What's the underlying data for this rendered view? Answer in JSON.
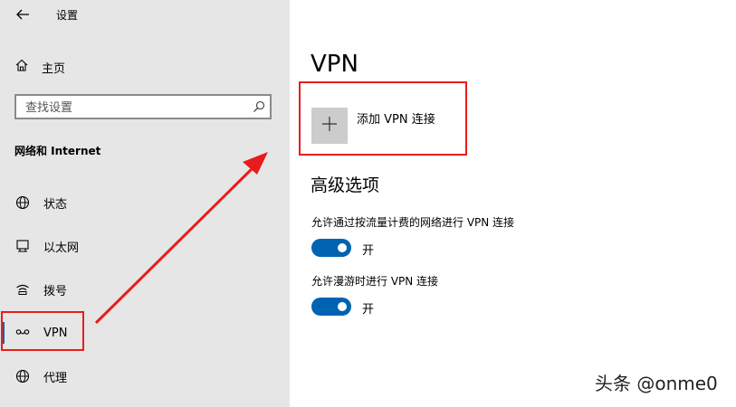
{
  "window": {
    "title": "设置"
  },
  "sidebar": {
    "home_label": "主页",
    "search_placeholder": "查找设置",
    "section_title": "网络和 Internet",
    "items": [
      {
        "label": "状态",
        "icon": "globe-status-icon"
      },
      {
        "label": "以太网",
        "icon": "ethernet-icon"
      },
      {
        "label": "拨号",
        "icon": "dialup-icon"
      },
      {
        "label": "VPN",
        "icon": "vpn-icon",
        "active": true
      },
      {
        "label": "代理",
        "icon": "globe-proxy-icon"
      }
    ]
  },
  "main": {
    "title": "VPN",
    "add_vpn_label": "添加 VPN 连接",
    "advanced_title": "高级选项",
    "options": [
      {
        "label": "允许通过按流量计费的网络进行 VPN 连接",
        "state": "开",
        "on": true
      },
      {
        "label": "允许漫游时进行 VPN 连接",
        "state": "开",
        "on": true
      }
    ]
  },
  "annotations": {
    "highlight_color": "#e81c1c"
  },
  "accent_color": "#0063b1",
  "watermark": "头条 @onme0"
}
